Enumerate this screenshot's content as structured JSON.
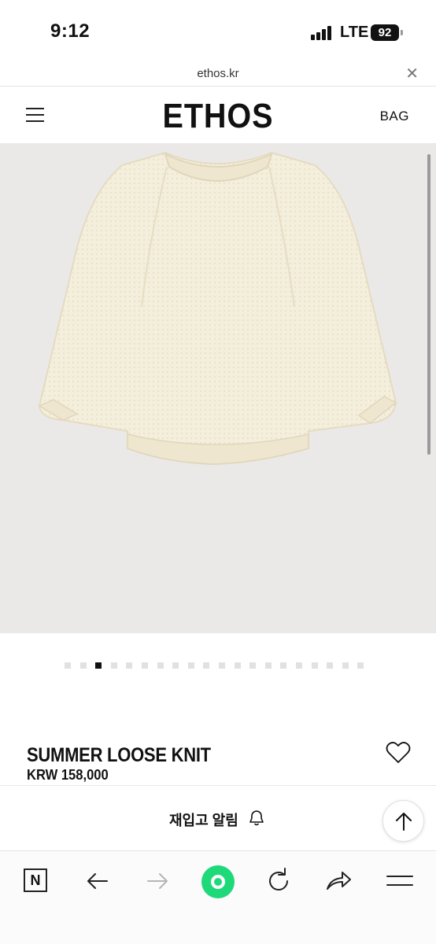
{
  "status": {
    "time": "9:12",
    "network": "LTE",
    "battery": "92"
  },
  "browser": {
    "url": "ethos.kr",
    "close_icon": "close-icon"
  },
  "header": {
    "logo": "ETHOS",
    "bag": "BAG",
    "menu_icon": "hamburger-icon"
  },
  "product": {
    "name": "SUMMER LOOSE KNIT",
    "price": "KRW 158,000",
    "image_total": 20,
    "image_index": 3,
    "colors": {
      "sweater": "#f3ecd9",
      "background": "#ebe9e8"
    }
  },
  "restock": {
    "label": "재입고 알림",
    "icon": "bell-icon"
  },
  "toolbar": {
    "home_icon": "naver-n-icon",
    "n_letter": "N"
  },
  "colors": {
    "accent_green": "#1ed97a",
    "text": "#111111"
  }
}
